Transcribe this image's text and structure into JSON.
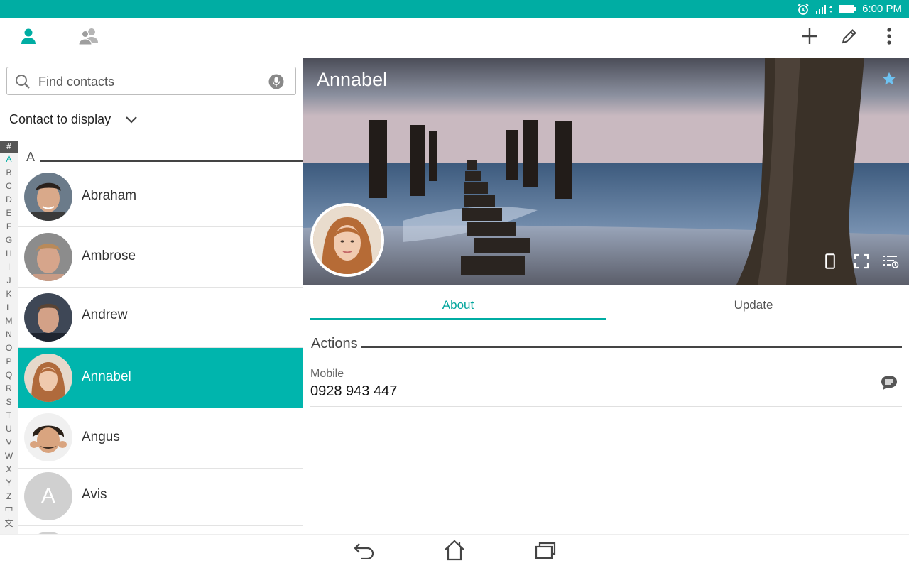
{
  "status_bar": {
    "time": "6:00 PM",
    "icons": [
      "alarm-icon",
      "signal-icon",
      "battery-icon"
    ],
    "color": "#00ada3"
  },
  "action_bar": {
    "tabs": [
      "person-icon",
      "group-icon"
    ],
    "actions": [
      "add-icon",
      "edit-icon",
      "more-vert-icon"
    ]
  },
  "search": {
    "placeholder": "Find contacts"
  },
  "filter": {
    "label": "Contact to display"
  },
  "alphabet": [
    "#",
    "A",
    "B",
    "C",
    "D",
    "E",
    "F",
    "G",
    "H",
    "I",
    "J",
    "K",
    "L",
    "M",
    "N",
    "O",
    "P",
    "Q",
    "R",
    "S",
    "T",
    "U",
    "V",
    "W",
    "X",
    "Y",
    "Z",
    "中",
    "文"
  ],
  "alphabet_active": "A",
  "section_letter": "A",
  "contacts": [
    {
      "name": "Abraham",
      "selected": false
    },
    {
      "name": "Ambrose",
      "selected": false
    },
    {
      "name": "Andrew",
      "selected": false
    },
    {
      "name": "Annabel",
      "selected": true
    },
    {
      "name": "Angus",
      "selected": false
    },
    {
      "name": "Avis",
      "selected": false,
      "initial": "A"
    }
  ],
  "detail": {
    "name": "Annabel",
    "favorite": true,
    "tabs": [
      {
        "label": "About",
        "active": true
      },
      {
        "label": "Update",
        "active": false
      }
    ],
    "actions_title": "Actions",
    "phone": {
      "label": "Mobile",
      "number": "0928 943 447"
    }
  },
  "navigation": [
    "back-icon",
    "home-icon",
    "recent-apps-icon"
  ],
  "accent_color": "#00ada3",
  "selected_color": "#00b5ad"
}
